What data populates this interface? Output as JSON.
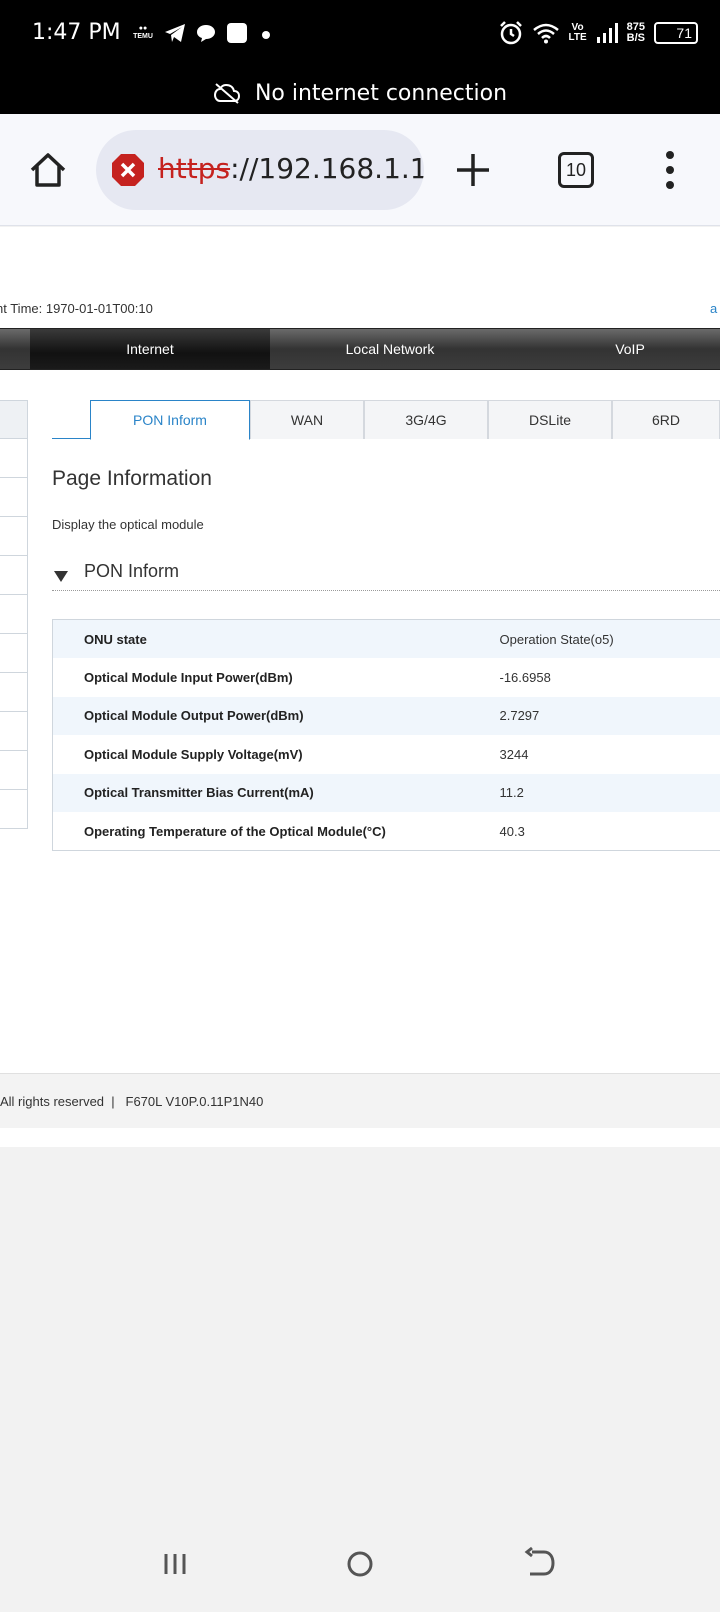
{
  "status_bar": {
    "time": "1:47 PM",
    "notif_label": "TEMU",
    "volte_top": "Vo",
    "volte_bottom": "LTE",
    "net_speed_value": "875",
    "net_speed_unit": "B/S",
    "battery_level": "71"
  },
  "banner": {
    "text": "No internet connection"
  },
  "browser": {
    "url_scheme": "https",
    "url_rest": "://192.168.1.1",
    "tab_count": "10"
  },
  "page": {
    "current_time": "nt Time: 1970-01-01T00:10",
    "edge_char": "a",
    "nav": [
      {
        "label": "Internet",
        "active": true
      },
      {
        "label": "Local Network",
        "active": false
      },
      {
        "label": "VoIP",
        "active": false
      }
    ],
    "subtabs": [
      {
        "label": "PON Inform",
        "active": true
      },
      {
        "label": "WAN",
        "active": false
      },
      {
        "label": "3G/4G",
        "active": false
      },
      {
        "label": "DSLite",
        "active": false
      },
      {
        "label": "6RD",
        "active": false
      }
    ],
    "title": "Page Information",
    "description": "Display the optical module",
    "section_title": "PON Inform",
    "rows": [
      {
        "label": "ONU state",
        "value": "Operation State(o5)"
      },
      {
        "label": "Optical Module Input Power(dBm)",
        "value": "-16.6958"
      },
      {
        "label": "Optical Module Output Power(dBm)",
        "value": "2.7297"
      },
      {
        "label": "Optical Module Supply Voltage(mV)",
        "value": "3244"
      },
      {
        "label": "Optical Transmitter Bias Current(mA)",
        "value": "11.2"
      },
      {
        "label": "Operating Temperature of the Optical Module(°C)",
        "value": "40.3"
      }
    ],
    "footer_rights": "All rights reserved",
    "footer_sep": "|",
    "footer_version": "F670L V10P.0.11P1N40"
  },
  "colors": {
    "accent": "#2a84c8",
    "error": "#c5221f",
    "nav_dark": "#333333"
  }
}
